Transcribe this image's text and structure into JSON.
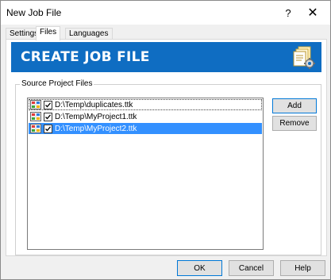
{
  "window": {
    "title": "New Job File",
    "help_glyph": "?",
    "close_glyph": "✕"
  },
  "tabs": [
    {
      "label": "Settings",
      "active": false
    },
    {
      "label": "Files",
      "active": true
    },
    {
      "label": "Languages",
      "active": false
    }
  ],
  "banner": {
    "title": "CREATE JOB FILE",
    "color": "#0f6dc2",
    "icon": "job-file-stack-gear-icon"
  },
  "group": {
    "label": "Source Project Files"
  },
  "files": [
    {
      "path": "D:\\Temp\\duplicates.ttk",
      "checked": true,
      "selected": false,
      "focused": true
    },
    {
      "path": "D:\\Temp\\MyProject1.ttk",
      "checked": true,
      "selected": false,
      "focused": false
    },
    {
      "path": "D:\\Temp\\MyProject2.ttk",
      "checked": true,
      "selected": true,
      "focused": false
    }
  ],
  "side_buttons": {
    "add": "Add",
    "remove": "Remove"
  },
  "footer": {
    "ok": "OK",
    "cancel": "Cancel",
    "help": "Help"
  },
  "colors": {
    "selection": "#3390ff",
    "default_button_border": "#0078d7"
  }
}
